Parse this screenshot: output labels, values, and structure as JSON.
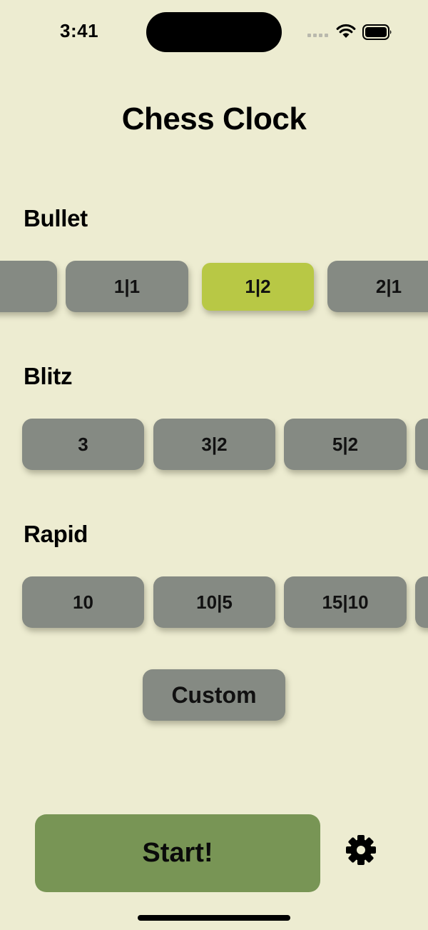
{
  "status_bar": {
    "time": "3:41"
  },
  "title": "Chess Clock",
  "sections": [
    {
      "name": "Bullet",
      "presets": [
        "",
        "1|1",
        "1|2",
        "2|1"
      ],
      "selected": "1|2"
    },
    {
      "name": "Blitz",
      "presets": [
        "3",
        "3|2",
        "5|2",
        ""
      ]
    },
    {
      "name": "Rapid",
      "presets": [
        "10",
        "10|5",
        "15|10",
        ""
      ]
    }
  ],
  "custom_label": "Custom",
  "start_label": "Start!",
  "icons": {
    "settings": "gear-icon",
    "wifi": "wifi-icon",
    "battery": "battery-icon",
    "signal": "cellular-signal-icon"
  },
  "colors": {
    "background": "#edecd1",
    "preset": "#858a83",
    "selected": "#b8c845",
    "start": "#789555"
  }
}
